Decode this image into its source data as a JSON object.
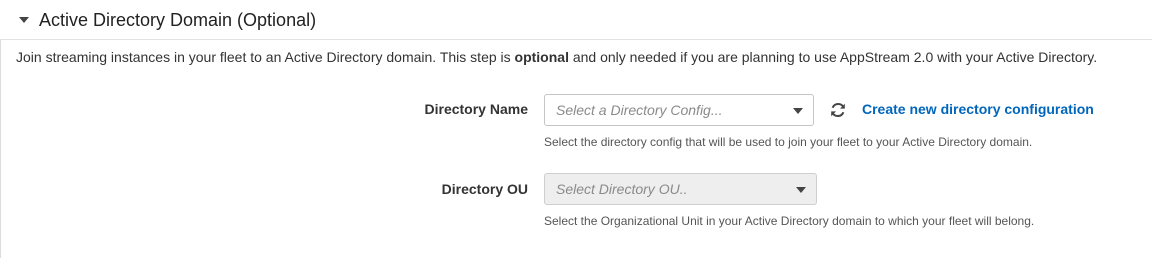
{
  "section": {
    "title": "Active Directory Domain (Optional)",
    "intro_before": "Join streaming instances in your fleet to an Active Directory domain. This step is ",
    "intro_bold": "optional",
    "intro_after": " and only needed if you are planning to use AppStream 2.0 with your Active Directory."
  },
  "directory_name": {
    "label": "Directory Name",
    "placeholder": "Select a Directory Config...",
    "help": "Select the directory config that will be used to join your fleet to your Active Directory domain.",
    "refresh_icon": "refresh-icon",
    "create_link": "Create new directory configuration"
  },
  "directory_ou": {
    "label": "Directory OU",
    "placeholder": "Select Directory OU..",
    "help": "Select the Organizational Unit in your Active Directory domain to which your fleet will belong.",
    "disabled": true
  },
  "colors": {
    "link": "#0066bb",
    "disabled_bg": "#eeeeee"
  }
}
